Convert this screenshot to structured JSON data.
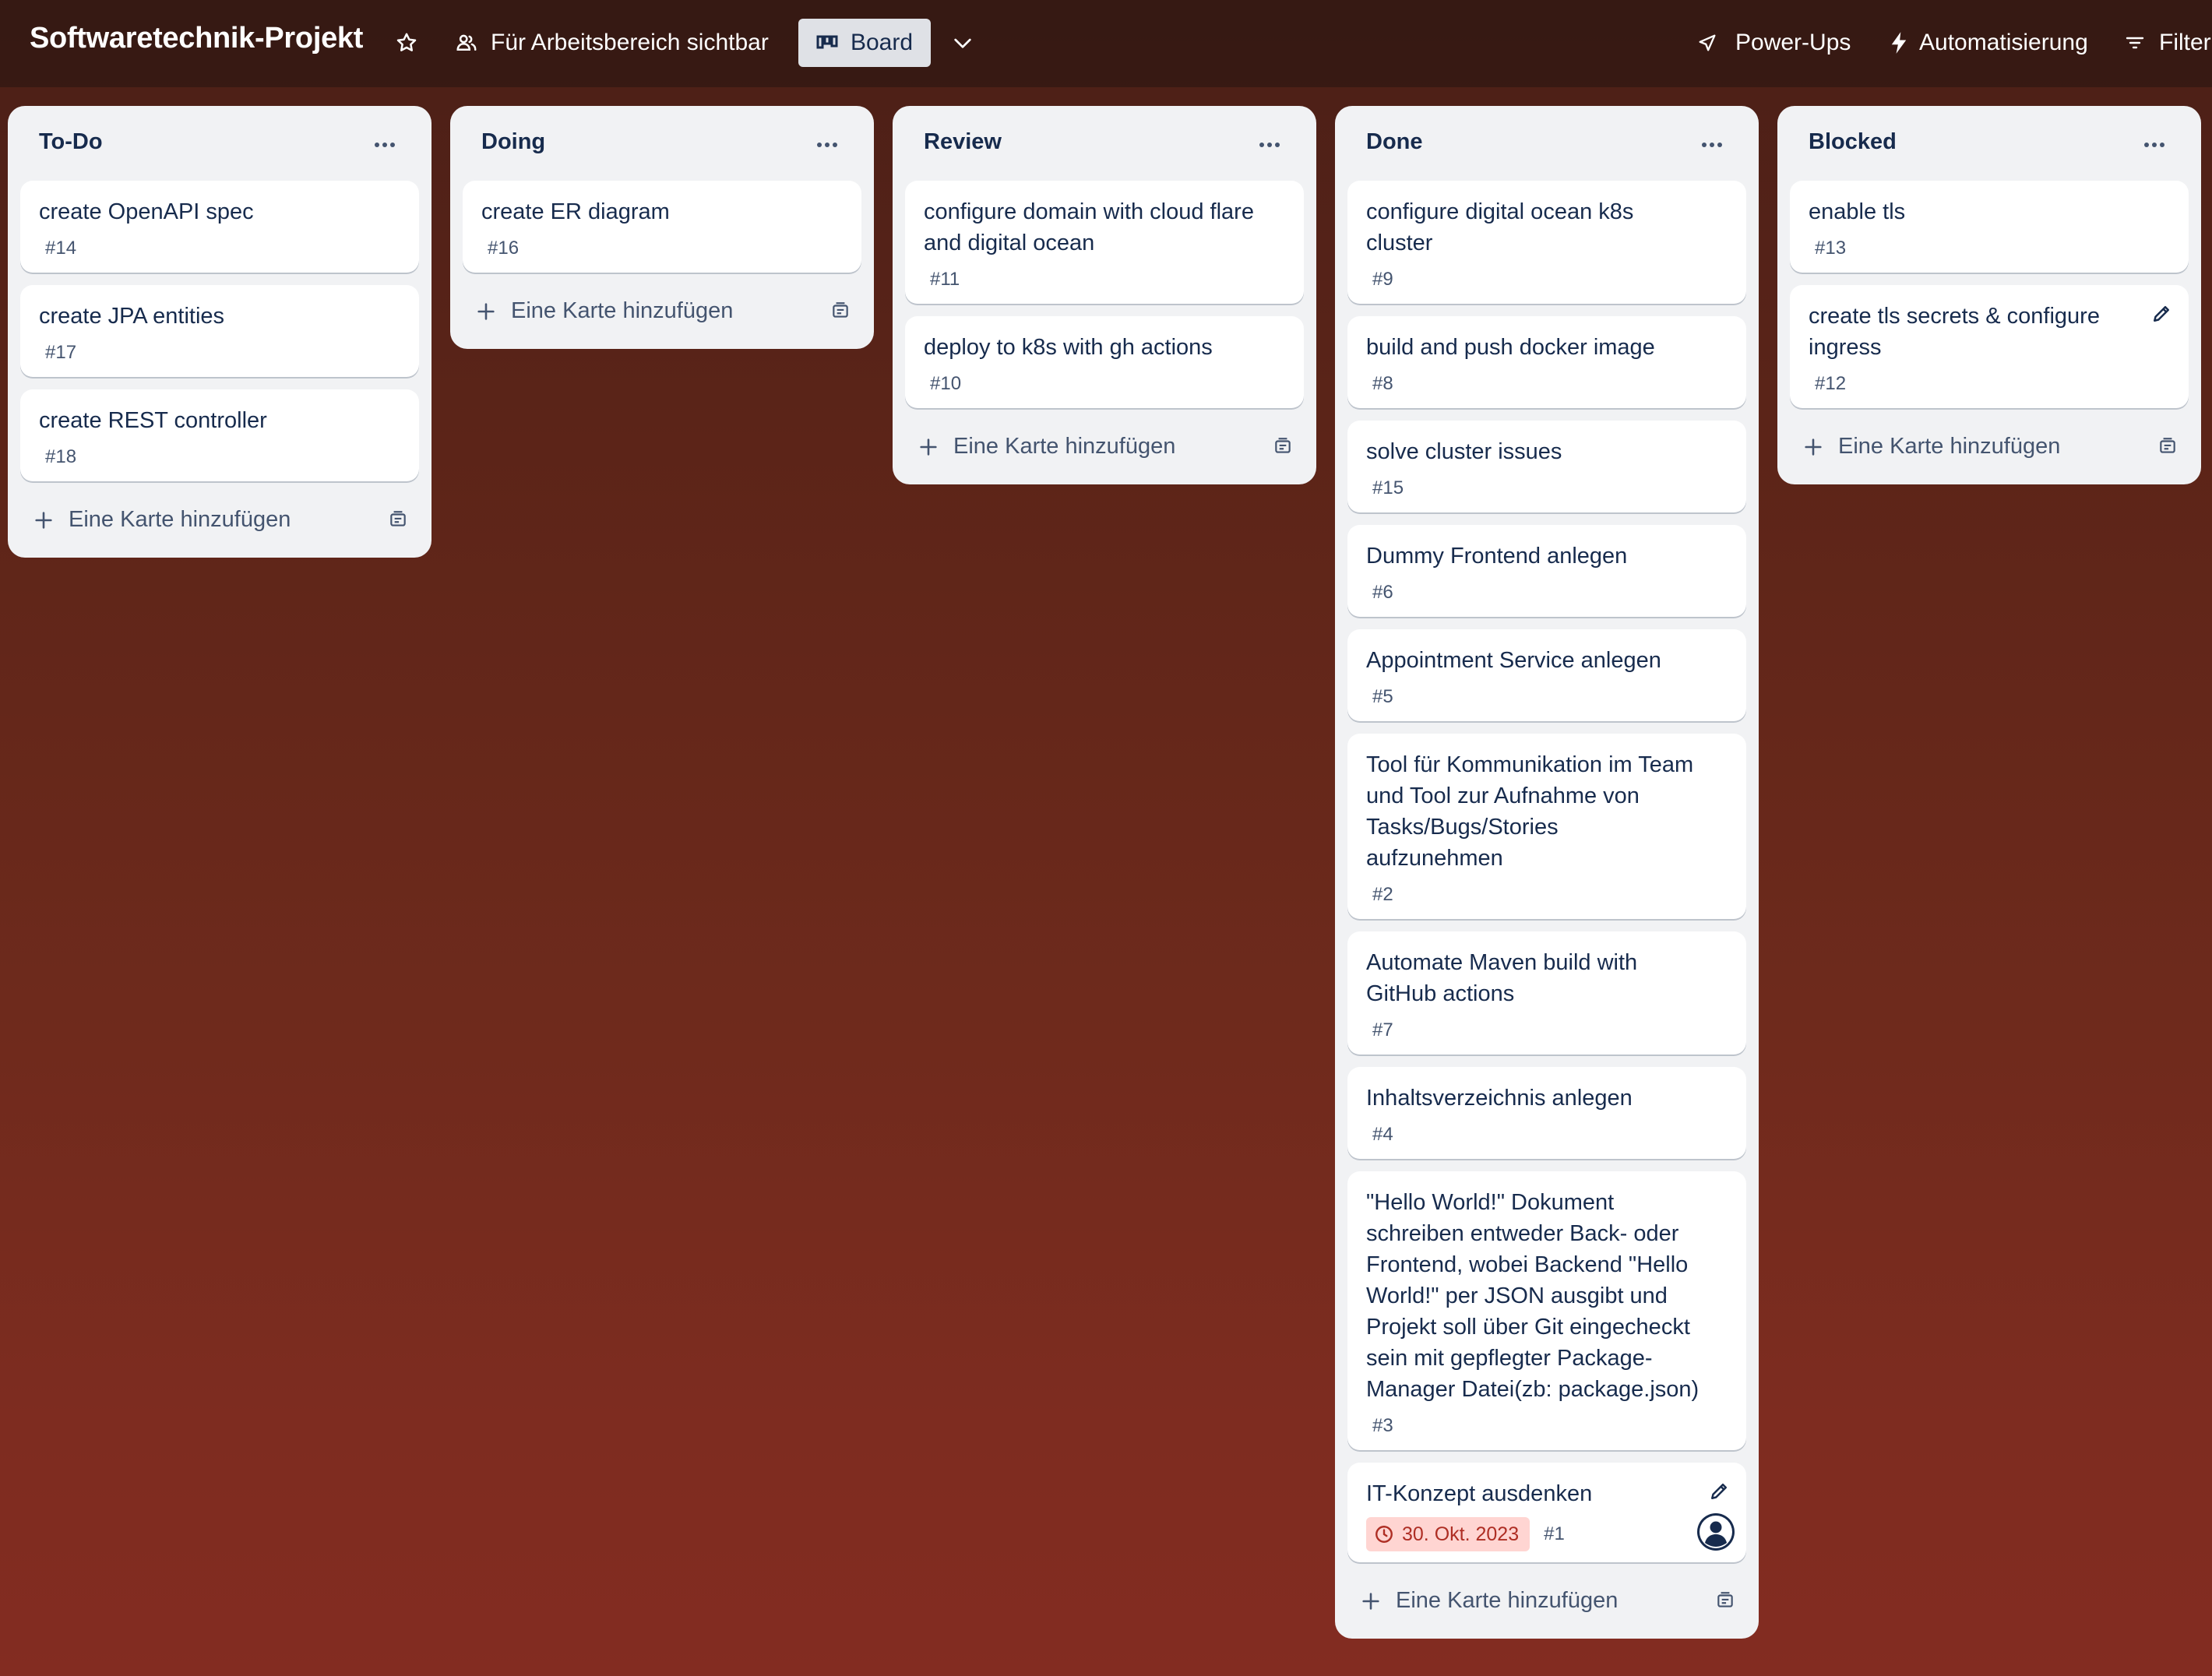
{
  "header": {
    "board_title": "Softwaretechnik-Projekt",
    "visibility_label": "Für Arbeitsbereich sichtbar",
    "view_label": "Board",
    "powerups_label": "Power-Ups",
    "automation_label": "Automatisierung",
    "filter_label": "Filter"
  },
  "lists": [
    {
      "title": "To-Do",
      "add_label": "Eine Karte hinzufügen",
      "cards": [
        {
          "title": "create OpenAPI spec",
          "number": "#14"
        },
        {
          "title": "create JPA entities",
          "number": "#17"
        },
        {
          "title": "create REST controller",
          "number": "#18"
        }
      ]
    },
    {
      "title": "Doing",
      "add_label": "Eine Karte hinzufügen",
      "cards": [
        {
          "title": "create ER diagram",
          "number": "#16"
        }
      ]
    },
    {
      "title": "Review",
      "add_label": "Eine Karte hinzufügen",
      "cards": [
        {
          "title": "configure domain with cloud flare and digital ocean",
          "number": "#11"
        },
        {
          "title": "deploy to k8s with gh actions",
          "number": "#10"
        }
      ]
    },
    {
      "title": "Done",
      "add_label": "Eine Karte hinzufügen",
      "cards": [
        {
          "title": "configure digital ocean k8s cluster",
          "number": "#9"
        },
        {
          "title": "build and push docker image",
          "number": "#8"
        },
        {
          "title": "solve cluster issues",
          "number": "#15"
        },
        {
          "title": "Dummy Frontend anlegen",
          "number": "#6"
        },
        {
          "title": "Appointment Service anlegen",
          "number": "#5"
        },
        {
          "title": "Tool für Kommunikation im Team und Tool zur Aufnahme von Tasks/Bugs/Stories aufzunehmen",
          "number": "#2"
        },
        {
          "title": "Automate Maven build with GitHub actions",
          "number": "#7"
        },
        {
          "title": "Inhaltsverzeichnis anlegen",
          "number": "#4"
        },
        {
          "title": "\"Hello World!\" Dokument schreiben entweder Back- oder Frontend, wobei Backend \"Hello World!\" per JSON ausgibt und Projekt soll über Git eingecheckt sein mit gepflegter Package-Manager Datei(zb: package.json)",
          "number": "#3"
        },
        {
          "title": "IT-Konzept ausdenken",
          "number": "#1",
          "due": "30. Okt. 2023"
        }
      ]
    },
    {
      "title": "Blocked",
      "add_label": "Eine Karte hinzufügen",
      "cards": [
        {
          "title": "enable tls",
          "number": "#13"
        },
        {
          "title": "create tls secrets & configure ingress",
          "number": "#12"
        }
      ]
    }
  ],
  "colors": {
    "due_badge_bg": "#ffd5d2",
    "due_badge_text": "#ae2e24",
    "list_bg": "#f1f2f4",
    "text_primary": "#172b4d"
  },
  "icons": {
    "star": "star-icon",
    "visibility": "people-icon",
    "board": "board-icon",
    "chevron": "chevron-down-icon",
    "powerups": "rocket-icon",
    "automation": "lightning-icon",
    "filter": "filter-icon",
    "list_menu": "ellipsis-icon",
    "add": "plus-icon",
    "template": "card-template-icon",
    "edit": "pencil-icon",
    "due": "clock-icon",
    "avatar": "user-avatar-icon"
  }
}
